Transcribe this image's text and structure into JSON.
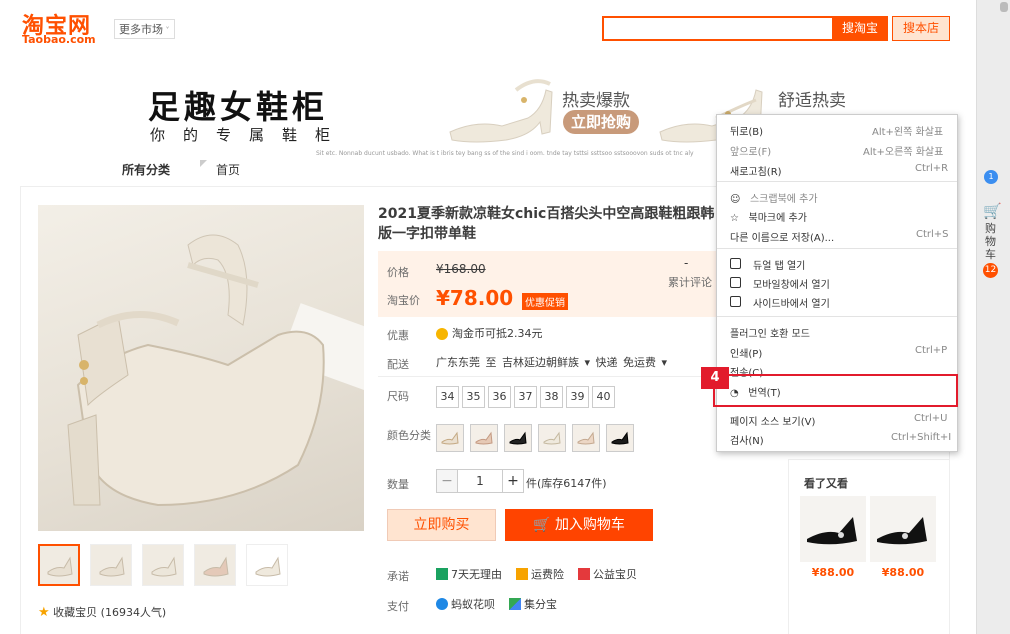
{
  "header": {
    "logo_cn": "淘宝网",
    "logo_en": "Taobao.com",
    "more_market": "更多市场",
    "search_btn": "搜淘宝",
    "shop_btn": "搜本店"
  },
  "banner": {
    "title": "足趣女鞋柜",
    "subtitle": "你的专属鞋柜",
    "small_text": "Sit etc. Nonnab ducunt usbado. What is t ibris tey bang ss of the sind i oom. tnde tay tsttsi ssttsoo sstsooovon suds ot tnc aly",
    "hot_label": "热卖爆款",
    "grab_label": "立即抢购",
    "comfort_label": "舒适热卖"
  },
  "nav": {
    "category": "所有分类",
    "home": "首页"
  },
  "product": {
    "title": "2021夏季新款凉鞋女chic百搭尖头中空高跟鞋粗跟韩版一字扣带单鞋",
    "price_label": "价格",
    "price_old": "¥168.00",
    "taobao_price_label": "淘宝价",
    "price_new": "¥78.00",
    "promo_tag": "优惠促销",
    "review_value": "-",
    "review_label": "累计评论",
    "discount_label": "优惠",
    "coin_text": "淘金币可抵2.34元",
    "ship_label": "配送",
    "ship_text": "广东东莞 至  吉林延边朝鲜族 ▾  快递 免运费 ▾",
    "size_label": "尺码",
    "sizes": [
      "34",
      "35",
      "36",
      "37",
      "38",
      "39",
      "40"
    ],
    "color_label": "颜色分类",
    "qty_label": "数量",
    "qty_minus": "−",
    "qty_value": "1",
    "qty_plus": "+",
    "stock": "件(库存6147件)",
    "buy_now": "立即购买",
    "add_cart": "加入购物车",
    "promise_label": "承诺",
    "promise_1": "7天无理由",
    "promise_2": "运费险",
    "promise_3": "公益宝贝",
    "pay_label": "支付",
    "pay_1": "蚂蚁花呗",
    "pay_2": "集分宝",
    "fav": "收藏宝贝 (16934人气)"
  },
  "recommend": {
    "title": "看了又看",
    "price_1": "¥88.00",
    "price_2": "¥88.00"
  },
  "sidebar": {
    "badge": "1",
    "cart_text": "购物车",
    "cart_count": "12"
  },
  "context_menu": {
    "back": "뒤로(B)",
    "back_sc": "Alt+왼쪽 화살표",
    "forward": "앞으로(F)",
    "forward_sc": "Alt+오른쪽 화살표",
    "refresh": "새로고침(R)",
    "refresh_sc": "Ctrl+R",
    "scrapbook": "스크랩북에 추가",
    "bookmark": "북마크에 추가",
    "save_as": "다른 이름으로 저장(A)...",
    "save_as_sc": "Ctrl+S",
    "dual_tab": "듀얼 탭 열기",
    "mobile": "모바일창에서 열기",
    "sidebar_open": "사이드바에서 열기",
    "plugin": "플러그인 호환 모드",
    "print": "인쇄(P)",
    "print_sc": "Ctrl+P",
    "all": "전송(C)",
    "translate": "번역(T)",
    "view_source": "페이지 소스 보기(V)",
    "view_source_sc": "Ctrl+U",
    "inspect": "검사(N)",
    "inspect_sc": "Ctrl+Shift+I"
  },
  "annotation": {
    "step": "4"
  },
  "colors": {
    "accent": "#ff5000",
    "highlight": "#e21b2c"
  }
}
